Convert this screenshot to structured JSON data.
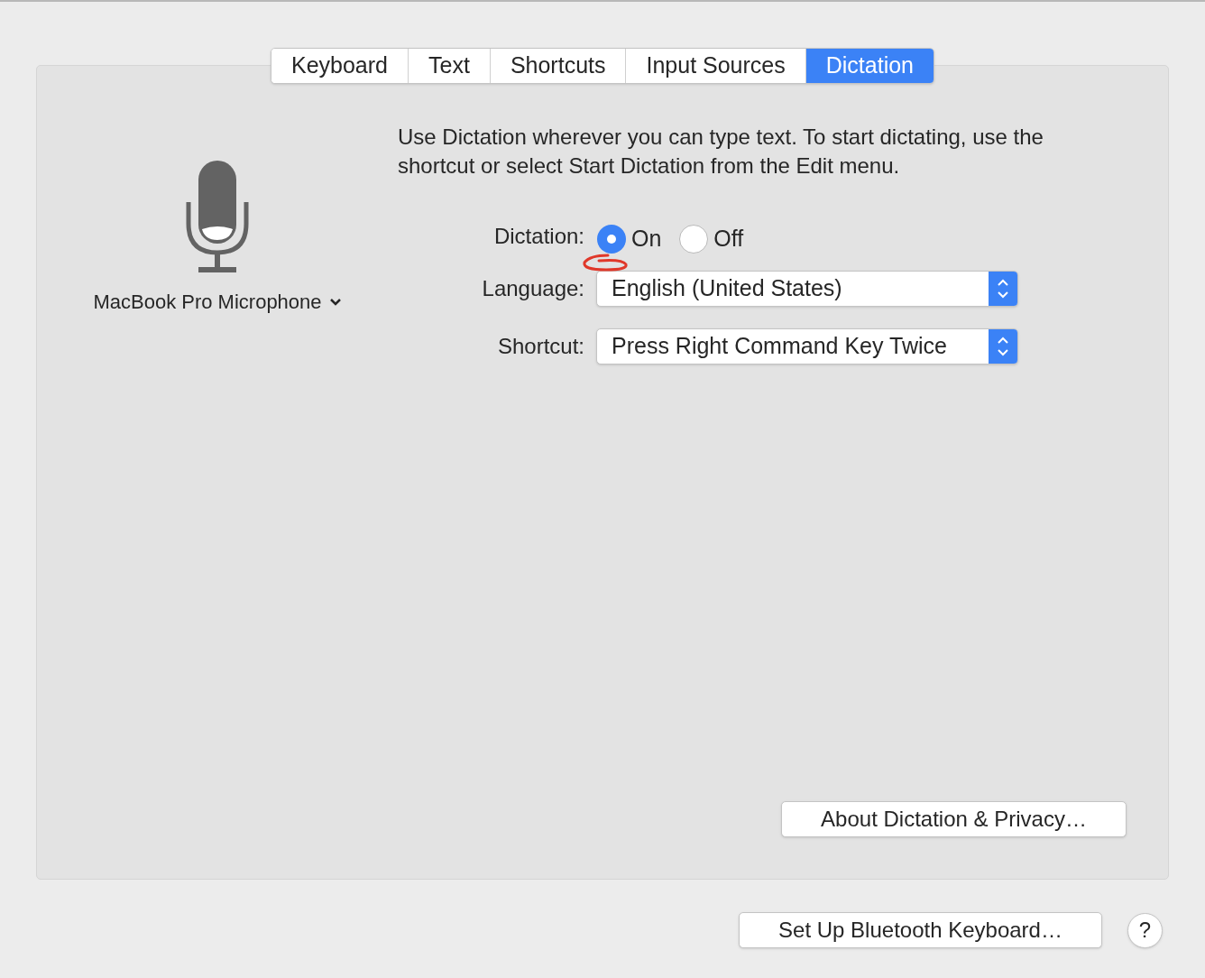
{
  "tabs": [
    {
      "label": "Keyboard",
      "selected": false
    },
    {
      "label": "Text",
      "selected": false
    },
    {
      "label": "Shortcuts",
      "selected": false
    },
    {
      "label": "Input Sources",
      "selected": false
    },
    {
      "label": "Dictation",
      "selected": true
    }
  ],
  "microphone": {
    "label": "MacBook Pro Microphone"
  },
  "description": "Use Dictation wherever you can type text. To start dictating, use the shortcut or select Start Dictation from the Edit menu.",
  "dictation": {
    "label": "Dictation:",
    "options": [
      {
        "label": "On",
        "selected": true
      },
      {
        "label": "Off",
        "selected": false
      }
    ]
  },
  "popups": [
    {
      "label": "Language:",
      "value": "English (United States)"
    },
    {
      "label": "Shortcut:",
      "value": "Press Right Command Key Twice"
    }
  ],
  "panel_button": "About Dictation & Privacy…",
  "bottom_button": "Set Up Bluetooth Keyboard…",
  "help": "?"
}
